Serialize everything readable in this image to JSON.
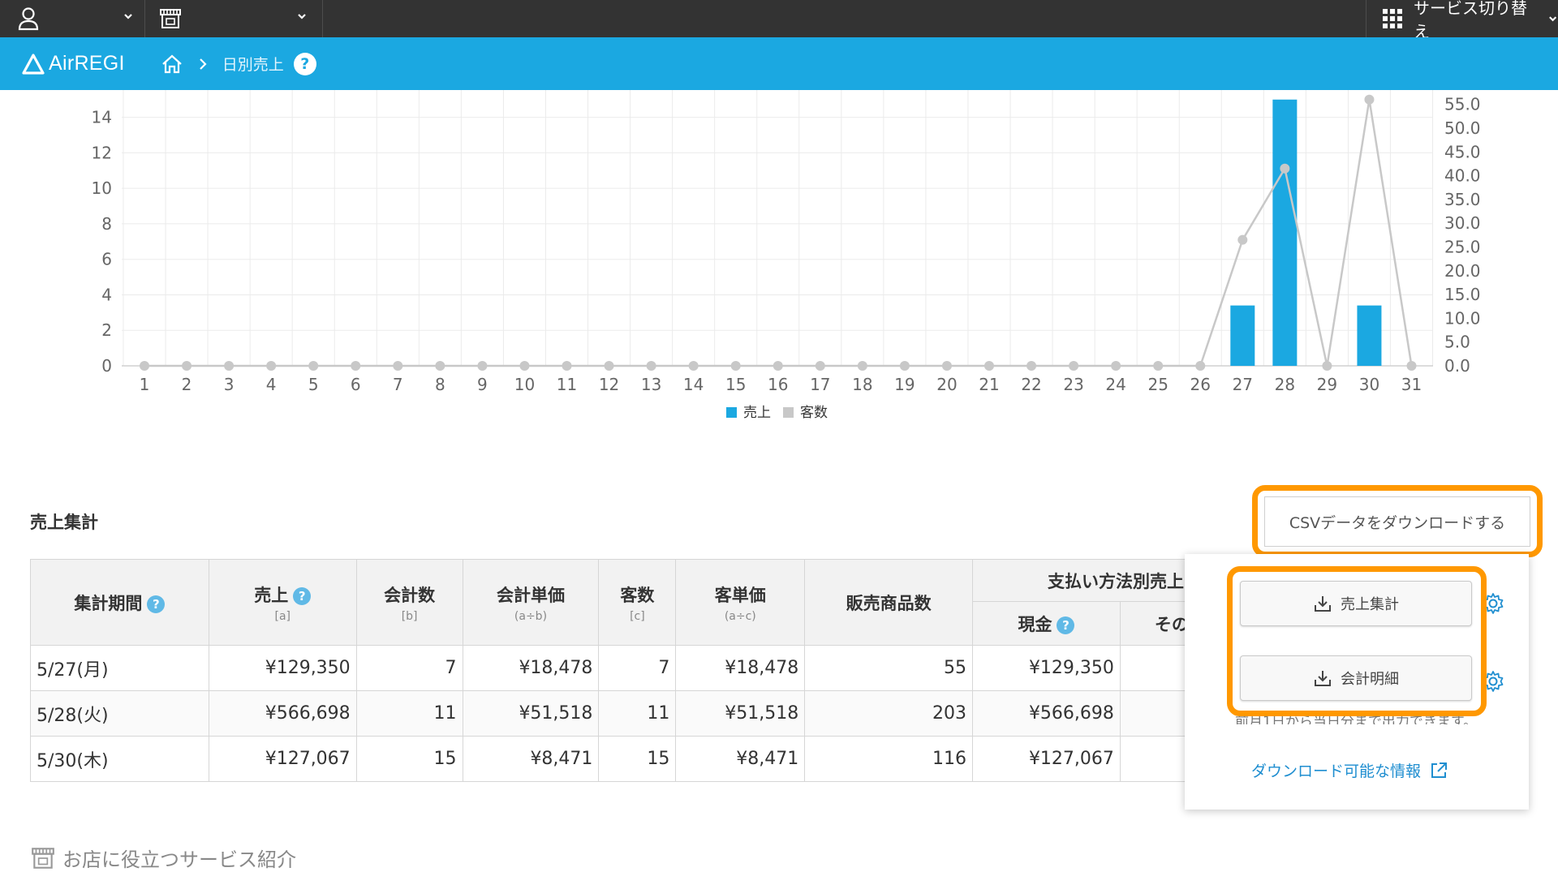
{
  "topbar": {
    "service_switch_label": "サービス切り替え",
    "icons": [
      "user-icon",
      "shop-icon",
      "grid-icon",
      "chevron-down-icon"
    ]
  },
  "header": {
    "logo_text": "AirREGI",
    "breadcrumb_page": "日別売上",
    "help_label": "?"
  },
  "chart_data": {
    "type": "bar",
    "categories": [
      "1",
      "2",
      "3",
      "4",
      "5",
      "6",
      "7",
      "8",
      "9",
      "10",
      "11",
      "12",
      "13",
      "14",
      "15",
      "16",
      "17",
      "18",
      "19",
      "20",
      "21",
      "22",
      "23",
      "24",
      "25",
      "26",
      "27",
      "28",
      "29",
      "30",
      "31"
    ],
    "series": [
      {
        "name": "売上",
        "type": "bar",
        "axis": "left",
        "color": "#1ba8e1",
        "values": [
          0,
          0,
          0,
          0,
          0,
          0,
          0,
          0,
          0,
          0,
          0,
          0,
          0,
          0,
          0,
          0,
          0,
          0,
          0,
          0,
          0,
          0,
          0,
          0,
          0,
          0,
          3.4,
          15,
          0,
          3.4,
          0
        ]
      },
      {
        "name": "客数",
        "type": "line",
        "axis": "right",
        "color": "#c8c8c8",
        "values": [
          0,
          0,
          0,
          0,
          0,
          0,
          0,
          0,
          0,
          0,
          0,
          0,
          0,
          0,
          0,
          0,
          0,
          0,
          0,
          0,
          0,
          0,
          0,
          0,
          0,
          0,
          26.5,
          41.5,
          0,
          56,
          0
        ]
      }
    ],
    "y_left_ticks": [
      "0",
      "2",
      "4",
      "6",
      "8",
      "10",
      "12",
      "14"
    ],
    "y_right_ticks": [
      "0.0",
      "5.0",
      "10.0",
      "15.0",
      "20.0",
      "25.0",
      "30.0",
      "35.0",
      "40.0",
      "45.0",
      "50.0",
      "55.0"
    ],
    "ylim_left": [
      0,
      15.4
    ],
    "ylim_right": [
      0,
      57.5
    ],
    "legend": [
      "売上",
      "客数"
    ],
    "legend_position": "bottom-center",
    "grid": true
  },
  "summary": {
    "title": "売上集計",
    "csv_button_label": "CSVデータをダウンロードする",
    "headers": {
      "period": "集計期間",
      "sales": "売上",
      "sales_sub": "[a]",
      "count": "会計数",
      "count_sub": "[b]",
      "unit_price": "会計単価",
      "unit_price_sub": "(a÷b)",
      "customers": "客数",
      "customers_sub": "[c]",
      "customer_price": "客単価",
      "customer_price_sub": "(a÷c)",
      "items": "販売商品数",
      "payment_group": "支払い方法別売上",
      "cash": "現金",
      "other": "その他"
    },
    "rows": [
      {
        "period": "5/27(月)",
        "sales": "¥129,350",
        "count": "7",
        "unit_price": "¥18,478",
        "customers": "7",
        "customer_price": "¥18,478",
        "items": "55",
        "cash": "¥129,350"
      },
      {
        "period": "5/28(火)",
        "sales": "¥566,698",
        "count": "11",
        "unit_price": "¥51,518",
        "customers": "11",
        "customer_price": "¥51,518",
        "items": "203",
        "cash": "¥566,698"
      },
      {
        "period": "5/30(木)",
        "sales": "¥127,067",
        "count": "15",
        "unit_price": "¥8,471",
        "customers": "15",
        "customer_price": "¥8,471",
        "items": "116",
        "cash": "¥127,067"
      }
    ]
  },
  "download_menu": {
    "summary_label": "売上集計",
    "detail_label": "会計明細",
    "note": "前月1日から当日分まで出力できます。",
    "link_label": "ダウンロード可能な情報"
  },
  "footer": {
    "services_label": "お店に役立つサービス紹介"
  }
}
